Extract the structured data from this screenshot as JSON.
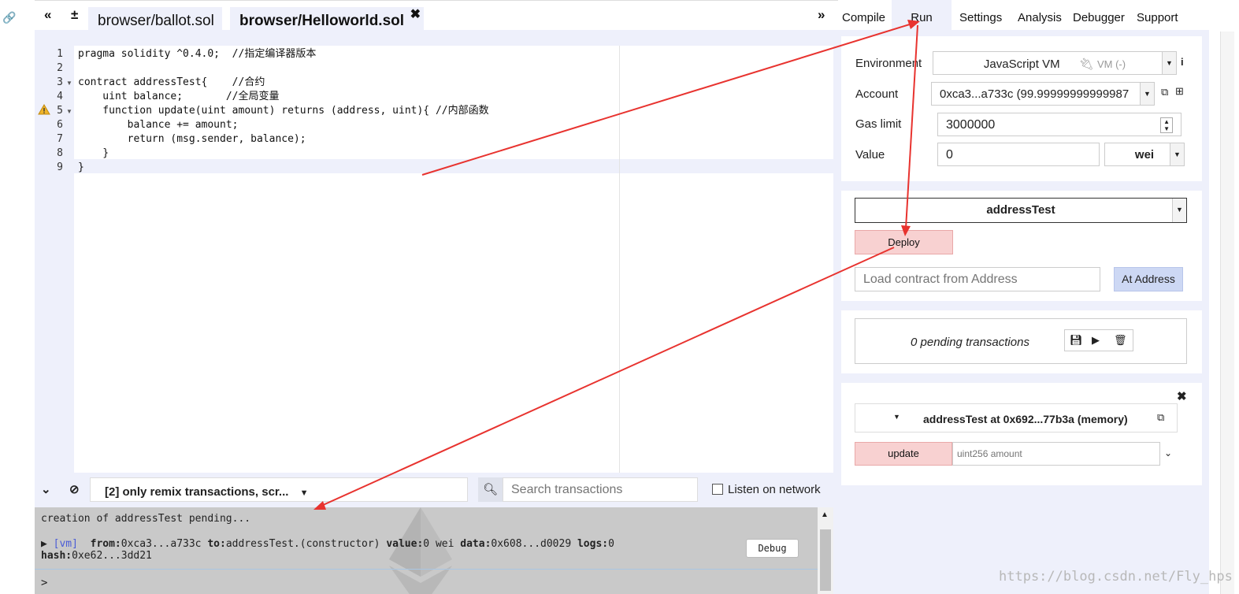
{
  "topbar": {
    "collapse_left": "«",
    "add_file": "±",
    "tabs": [
      {
        "label": "browser/ballot.sol"
      },
      {
        "label": "browser/Helloworld.sol",
        "close": "✖"
      }
    ],
    "collapse_right": "»"
  },
  "editor": {
    "line_numbers": [
      "1",
      "2",
      "3",
      "4",
      "5",
      "6",
      "7",
      "8",
      "9"
    ],
    "lines": [
      {
        "text": "pragma solidity ^0.4.0;  //指定编译器版本"
      },
      {
        "text": ""
      },
      {
        "text": "contract addressTest{    //合约"
      },
      {
        "text": "    uint balance;       //全局变量"
      },
      {
        "text": "    function update(uint amount) returns (address, uint){ //内部函数"
      },
      {
        "text": "        balance += amount;"
      },
      {
        "text": "        return (msg.sender, balance);"
      },
      {
        "text": "    }"
      },
      {
        "text": "}"
      }
    ]
  },
  "terminal": {
    "filter_label": "[2] only remix transactions, scr...",
    "search_placeholder": "Search transactions",
    "listen_label": "Listen on network",
    "pending_text": "creation of addressTest pending...",
    "tx": {
      "tag": "[vm]",
      "from_key": "from:",
      "from_val": "0xca3...a733c",
      "to_key": "to:",
      "to_val": "addressTest.(constructor)",
      "value_key": "value:",
      "value_val": "0 wei",
      "data_key": "data:",
      "data_val": "0x608...d0029",
      "logs_key": "logs:",
      "logs_val": "0",
      "hash_key": "hash:",
      "hash_val": "0xe62...3dd21"
    },
    "debug_label": "Debug",
    "prompt": ">"
  },
  "right_tabs": [
    "Compile",
    "Run",
    "Settings",
    "Analysis",
    "Debugger",
    "Support"
  ],
  "run": {
    "environment_label": "Environment",
    "environment_value": "JavaScript VM",
    "vm_label": "VM (-)",
    "account_label": "Account",
    "account_value": "0xca3...a733c (99.99999999999987",
    "gas_label": "Gas limit",
    "gas_value": "3000000",
    "value_label": "Value",
    "value_value": "0",
    "value_unit": "wei",
    "contract_select": "addressTest",
    "deploy_label": "Deploy",
    "load_placeholder": "Load contract from Address",
    "at_address_label": "At Address",
    "pending_tx": "0 pending transactions",
    "instance_title": "addressTest at 0x692...77b3a (memory)",
    "update_label": "update",
    "update_placeholder": "uint256 amount"
  },
  "watermark": "https://blog.csdn.net/Fly_hps",
  "colors": {
    "accent_panel": "#eef0fb",
    "button_red": "#f8d1d1",
    "annotation_arrow": "#e8332f"
  }
}
